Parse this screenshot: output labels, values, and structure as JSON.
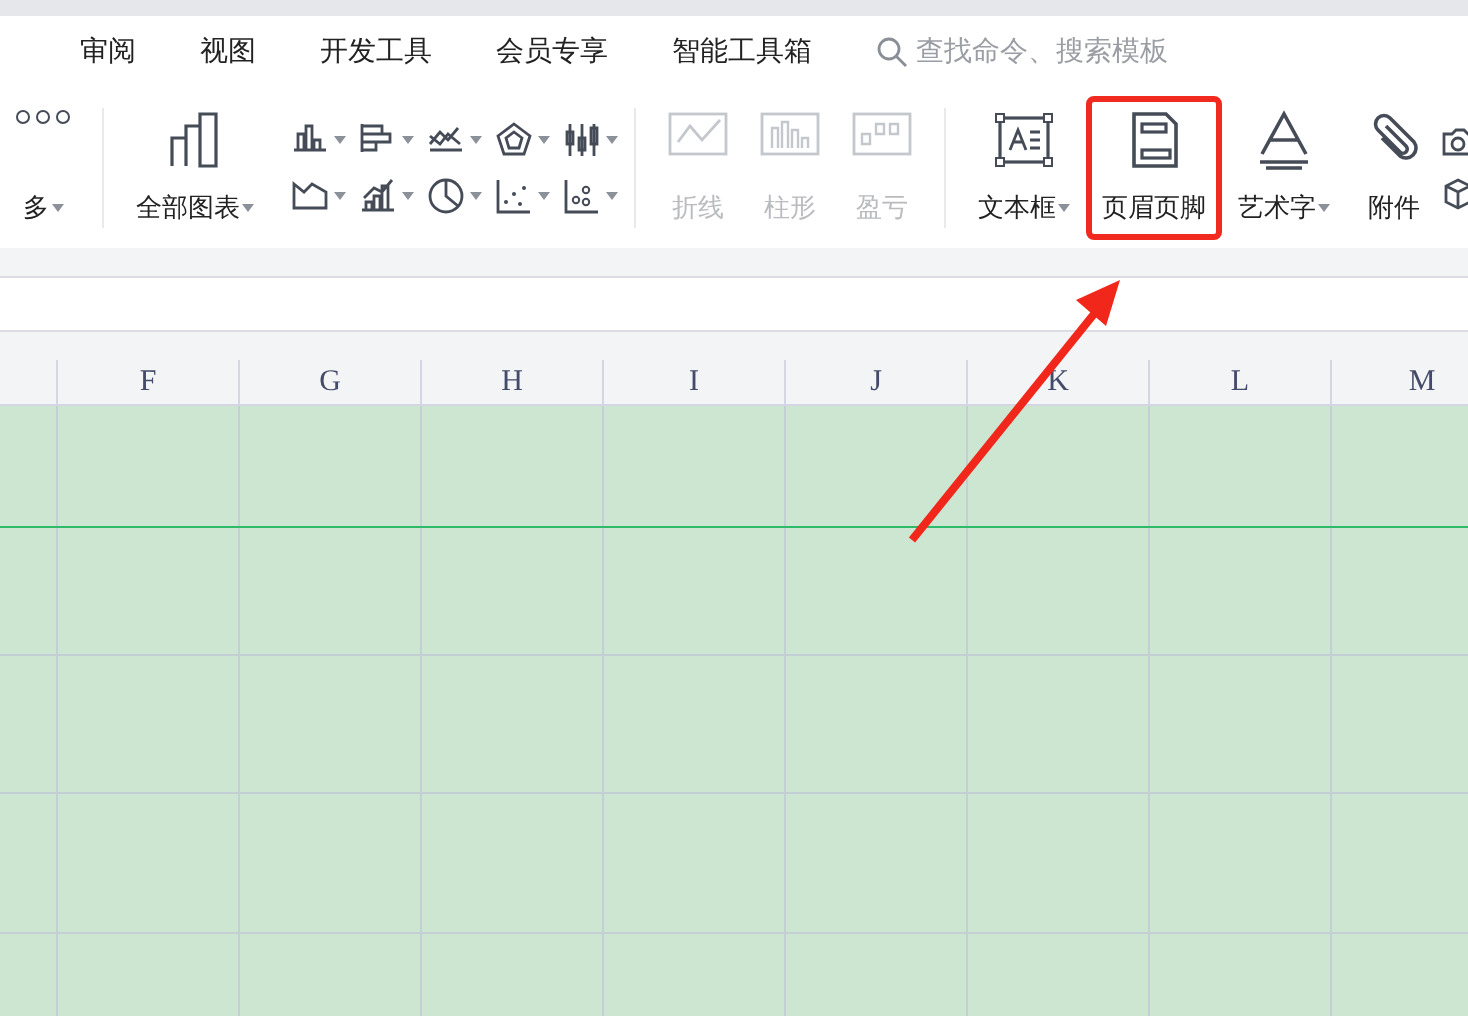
{
  "menu_tabs": [
    {
      "label": "审阅",
      "selected": false
    },
    {
      "label": "视图",
      "selected": false
    },
    {
      "label": "开发工具",
      "selected": false
    },
    {
      "label": "会员专享",
      "selected": false
    },
    {
      "label": "智能工具箱",
      "selected": false
    }
  ],
  "search": {
    "placeholder": "查找命令、搜索模板"
  },
  "more": {
    "label": "多",
    "dropdown": true
  },
  "all_charts": {
    "label": "全部图表",
    "dropdown": true
  },
  "chart_buttons": [
    {
      "dropdown": true
    },
    {
      "dropdown": true
    },
    {
      "dropdown": true
    },
    {
      "dropdown": true
    },
    {
      "dropdown": true
    },
    {
      "dropdown": true
    },
    {
      "dropdown": true
    },
    {
      "dropdown": true
    },
    {
      "dropdown": true
    },
    {
      "dropdown": true
    }
  ],
  "sparklines": [
    {
      "label": "折线",
      "disabled": true
    },
    {
      "label": "柱形",
      "disabled": true
    },
    {
      "label": "盈亏",
      "disabled": true
    }
  ],
  "insert_items": [
    {
      "label": "文本框",
      "dropdown": true,
      "highlighted": false
    },
    {
      "label": "页眉页脚",
      "dropdown": false,
      "highlighted": true
    },
    {
      "label": "艺术字",
      "dropdown": true,
      "highlighted": false
    },
    {
      "label": "附件",
      "dropdown": false,
      "highlighted": false
    }
  ],
  "columns": [
    "F",
    "G",
    "H",
    "I",
    "J",
    "K",
    "L",
    "M"
  ]
}
